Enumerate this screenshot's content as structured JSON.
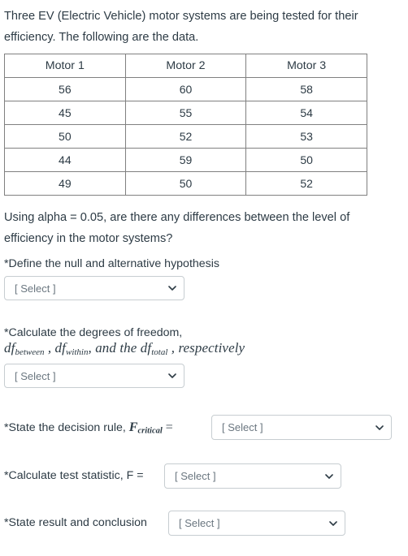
{
  "intro": {
    "text": "Three EV (Electric Vehicle) motor systems are being tested for their efficiency. The following are the data."
  },
  "table": {
    "headers": [
      "Motor 1",
      "Motor 2",
      "Motor 3"
    ],
    "rows": [
      [
        "56",
        "60",
        "58"
      ],
      [
        "45",
        "55",
        "54"
      ],
      [
        "50",
        "52",
        "53"
      ],
      [
        "44",
        "59",
        "50"
      ],
      [
        "49",
        "50",
        "52"
      ]
    ]
  },
  "question": {
    "text": "Using alpha = 0.05, are there any differences between the level of efficiency in the motor systems?"
  },
  "steps": {
    "hypothesis": {
      "label": "*Define the null and alternative hypothesis",
      "select_value": "[ Select ]"
    },
    "degrees_of_freedom": {
      "label": "*Calculate the degrees of freedom,",
      "math": {
        "df1_base": "df",
        "df1_sub": "between",
        "sep1": " , ",
        "df2_base": "df",
        "df2_sub": "within",
        "sep2": ", ",
        "connector": "and the ",
        "df3_base": "df",
        "df3_sub": "total",
        "sep3": " , ",
        "tail": "respectively"
      },
      "select_value": "[ Select ]"
    },
    "decision_rule": {
      "label": "*State the decision rule, ",
      "symbol_base": "F",
      "symbol_sub": "critical",
      "equals": "=",
      "select_value": "[ Select ]"
    },
    "test_statistic": {
      "label": "*Calculate test statistic, F =",
      "select_value": "[ Select ]"
    },
    "result_conclusion": {
      "label": "*State result and conclusion",
      "select_value": "[ Select ]"
    }
  },
  "colors": {
    "text": "#2d3b45",
    "border": "#808080",
    "select_border": "#c7cdd1",
    "placeholder": "#6b7780"
  }
}
